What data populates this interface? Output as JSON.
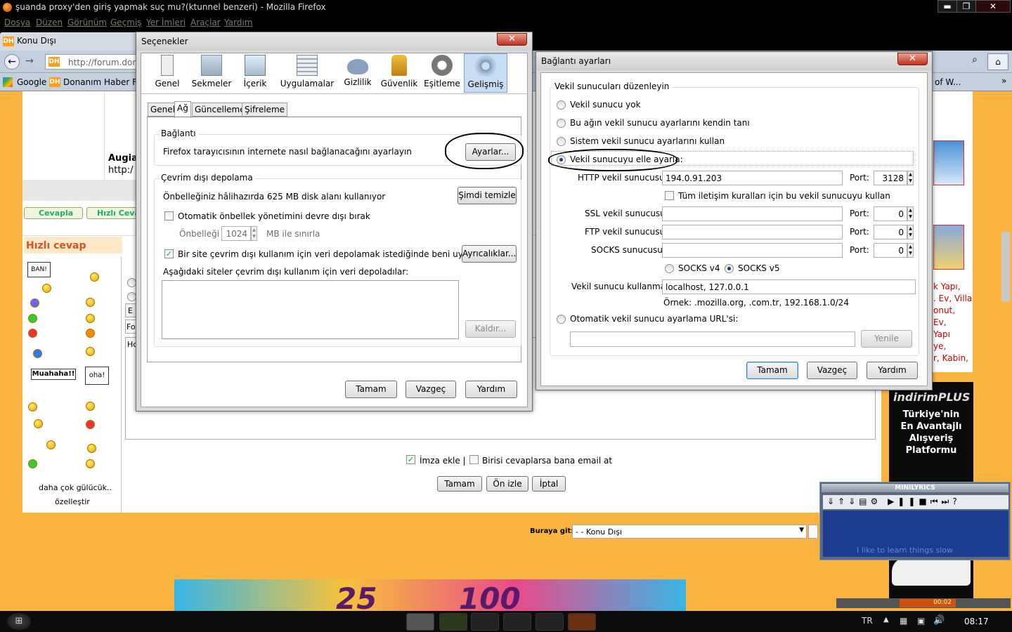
{
  "window": {
    "title": "şuanda proxy'den giriş yapmak suç mu?(ktunnel benzeri) - Mozilla Firefox",
    "min": "▬",
    "max": "❐",
    "close": "✕"
  },
  "menu": [
    "Dosya",
    "Düzen",
    "Görünüm",
    "Geçmiş",
    "Yer İmleri",
    "Araçlar",
    "Yardım"
  ],
  "tab": {
    "dh": "DH",
    "label": "Konu Dışı"
  },
  "nav": {
    "url": "http://forum.dona",
    "back": "←",
    "fwd": "→"
  },
  "bookmarks": {
    "google": "Google",
    "dh": "Donanım Haber Foru",
    "right": "of W...",
    "more": "»"
  },
  "forum": {
    "user_name": "Augia",
    "user_link": "http:/",
    "reply_btn": "Cevapla",
    "quick_btn": "Hızlı Ceva",
    "quick_reply_title": "Hızlı cevap",
    "smiley_ban": "BAN!",
    "smiley_muahaha": "Muahaha!!",
    "smiley_oha": "oha!",
    "more_smileys": "daha çok gülücük..",
    "customize": "özelleştir",
    "sig_label": "İmza ekle |",
    "email_label": "Birisi cevaplarsa bana email at",
    "btn_ok": "Tamam",
    "btn_preview": "Ön izle",
    "btn_cancel": "İptal",
    "goto_label": "Buraya git:",
    "goto_value": "- - Konu Dışı",
    "field_fo": "Fo",
    "field_ho": "Ho",
    "field_e": "E",
    "side_ad": [
      "k Yapı,",
      ". Ev, Villa",
      "onut,",
      "Ev,",
      "Yapı",
      "ye,",
      "r, Kabin,"
    ],
    "banner_nums": [
      "25",
      "100"
    ],
    "ad_brand": "indirimPLUS",
    "ad_text": [
      "Türkiye'nin",
      "En Avantajlı",
      "Alışveriş",
      "Platformu"
    ]
  },
  "options": {
    "title": "Seçenekler",
    "categories": [
      "Genel",
      "Sekmeler",
      "İçerik",
      "Uygulamalar",
      "Gizlilik",
      "Güvenlik",
      "Eşitleme",
      "Gelişmiş"
    ],
    "subtabs": [
      "Genel",
      "Ağ",
      "Güncelleme",
      "Şifreleme"
    ],
    "connection_group": "Bağlantı",
    "connection_desc": "Firefox tarayıcısının internete nasıl bağlanacağını ayarlayın",
    "settings_btn": "Ayarlar...",
    "offline_group": "Çevrim dışı depolama",
    "cache_text": "Önbelleğiniz hâlihazırda 625 MB disk alanı kullanıyor",
    "clear_btn": "Şimdi temizle",
    "override_cache": "Otomatik önbellek yönetimini devre dışı bırak",
    "cache_limit_label": "Önbelleği",
    "cache_limit_value": "1024",
    "cache_limit_unit": "MB ile sınırla",
    "warn_label": "Bir site çevrim dışı kullanım için veri depolamak istediğinde beni uyar",
    "exceptions_btn": "Ayrıcalıklar...",
    "sites_label": "Aşağıdaki siteler çevrim dışı kullanım için veri depoladılar:",
    "remove_btn": "Kaldır...",
    "ok": "Tamam",
    "cancel": "Vazgeç",
    "help": "Yardım"
  },
  "proxy": {
    "title": "Bağlantı ayarları",
    "group": "Vekil sunucuları düzenleyin",
    "opt_none": "Vekil sunucu yok",
    "opt_auto_detect": "Bu ağın vekil sunucu ayarlarını kendin tanı",
    "opt_system": "Sistem vekil sunucu ayarlarını kullan",
    "opt_manual": "Vekil sunucuyu elle ayarla:",
    "http_label": "HTTP vekil sunucusu:",
    "http_value": "194.0.91.203",
    "http_port": "3128",
    "port_label": "Port:",
    "all_protocols": "Tüm iletişim kuralları için bu vekil sunucuyu kullan",
    "ssl_label": "SSL vekil sunucusu:",
    "ssl_port": "0",
    "ftp_label": "FTP vekil sunucusu:",
    "ftp_port": "0",
    "socks_label": "SOCKS sunucusu:",
    "socks_port": "0",
    "socks4": "SOCKS v4",
    "socks5": "SOCKS v5",
    "no_proxy_label": "Vekil sunucu kullanma:",
    "no_proxy_value": "localhost, 127.0.0.1",
    "example": "Örnek: .mozilla.org, .com.tr, 192.168.1.0/24",
    "opt_pac": "Otomatik vekil sunucu ayarlama URL'si:",
    "reload_btn": "Yenile",
    "ok": "Tamam",
    "cancel": "Vazgeç",
    "help": "Yardım"
  },
  "minilyrics": {
    "title": "MINILYRICS",
    "lyric": "I like to learn things slow",
    "time": "00:02"
  },
  "taskbar": {
    "lang": "TR",
    "time": "08:17"
  },
  "colors": {
    "page_bg": "#f9b53f",
    "quick_reply_title": "#d9531e",
    "ad_bg": "#0b0b0b"
  }
}
